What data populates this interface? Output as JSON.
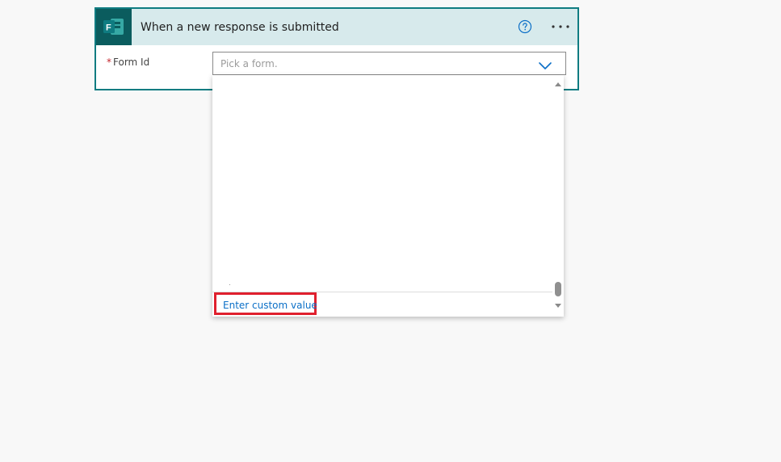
{
  "trigger_card": {
    "title": "When a new response is submitted",
    "app_icon_letter": "F",
    "icons": {
      "app": "microsoft-forms-icon",
      "help": "help-circle-icon",
      "more": "more-options-icon"
    },
    "colors": {
      "border": "#0f7c81",
      "header_bg": "#d7eaec",
      "app_icon_bg": "#0b5c5e",
      "help_icon": "#0b6fc7"
    }
  },
  "form_id_field": {
    "required_marker": "*",
    "label": "Form Id",
    "placeholder": "Pick a form.",
    "chevron_icon": "chevron-down-icon"
  },
  "dropdown": {
    "custom_value_label": "Enter custom value",
    "highlight_color": "#e0202e",
    "link_color": "#0b6fc7",
    "scroll_up_icon": "scroll-up-arrow-icon",
    "scroll_down_icon": "scroll-down-arrow-icon"
  }
}
